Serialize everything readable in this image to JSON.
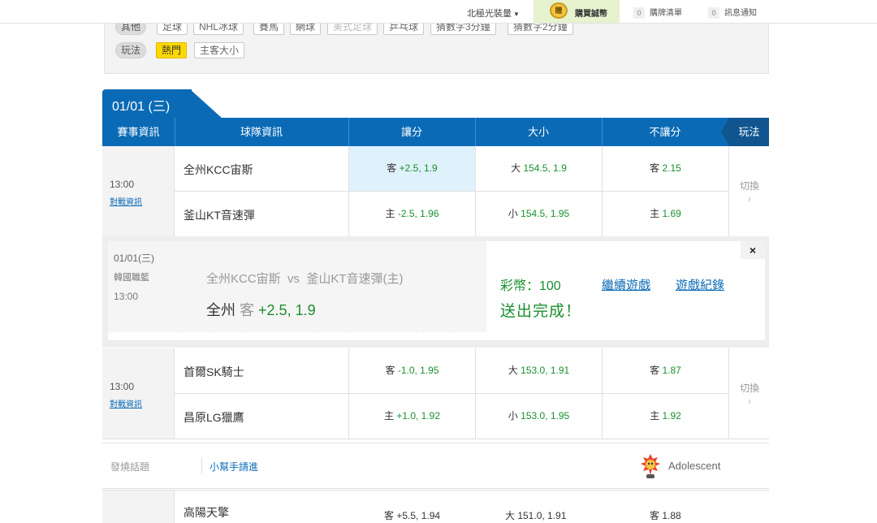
{
  "topbar": {
    "user": "北極光裝量",
    "buy_coin": "贈",
    "buy_label": "購買誠幣",
    "cart_count": "0",
    "cart_label": "購牌清單",
    "msg_count": "0",
    "msg_label": "訊息通知"
  },
  "filters": {
    "row1_label": "其他",
    "row1": [
      "足球",
      "NHL冰球",
      "賽馬",
      "網球",
      "美式足球",
      "乒乓球",
      "猜數字3分鐘",
      "猜數字2分鐘"
    ],
    "row2_label": "玩法",
    "row2_active": "熱門",
    "row2": [
      "主客大小"
    ]
  },
  "date_tab": "01/01 (三)",
  "header": {
    "event": "賽事資訊",
    "teams": "球隊資訊",
    "spread": "讓分",
    "total": "大小",
    "moneyline": "不讓分",
    "play": "玩法"
  },
  "matches": [
    {
      "time": "13:00",
      "link": "對戰資訊",
      "away": "全州KCC宙斯",
      "home": "釜山KT音速彈",
      "away_spread_side": "客",
      "away_spread": "+2.5, 1.9",
      "home_spread_side": "主",
      "home_spread": "-2.5, 1.96",
      "over_side": "大",
      "over": "154.5, 1.9",
      "under_side": "小",
      "under": "154.5, 1.95",
      "away_ml_side": "客",
      "away_ml": "2.15",
      "home_ml_side": "主",
      "home_ml": "1.69",
      "switch": "切換",
      "chevron": "›"
    },
    {
      "time": "13:00",
      "link": "對戰資訊",
      "away": "首爾SK騎士",
      "home": "昌原LG獵鷹",
      "away_spread_side": "客",
      "away_spread": "-1.0, 1.95",
      "home_spread_side": "主",
      "home_spread": "+1.0, 1.92",
      "over_side": "大",
      "over": "153.0, 1.91",
      "under_side": "小",
      "under": "153.0, 1.95",
      "away_ml_side": "客",
      "away_ml": "1.87",
      "home_ml_side": "主",
      "home_ml": "1.92",
      "switch": "切換",
      "chevron": "›"
    }
  ],
  "confirm": {
    "date": "01/01(三)",
    "league": "韓國職籃",
    "time": "13:00",
    "matchup": "全州KCC宙斯  vs  釜山KT音速彈(主)",
    "pick_team": "全州",
    "pick_side": "客",
    "pick_value": "+2.5, 1.9",
    "coins": "彩幣：100",
    "done": "送出完成！",
    "continue": "繼續遊戲",
    "history": "遊戲紀錄",
    "close": "×"
  },
  "topics": {
    "label": "發燒話題",
    "link": "小幫手請進",
    "user": "Adolescent"
  },
  "next_row": {
    "team": "高陽天擎",
    "a": "客 +5.5, 1.94",
    "b": "大 151.0, 1.91",
    "c": "客 1.88"
  },
  "colors": {
    "brand_blue": "#0a6ab5",
    "odds_green": "#1a8f2e",
    "hot_yellow": "#ffd800"
  }
}
